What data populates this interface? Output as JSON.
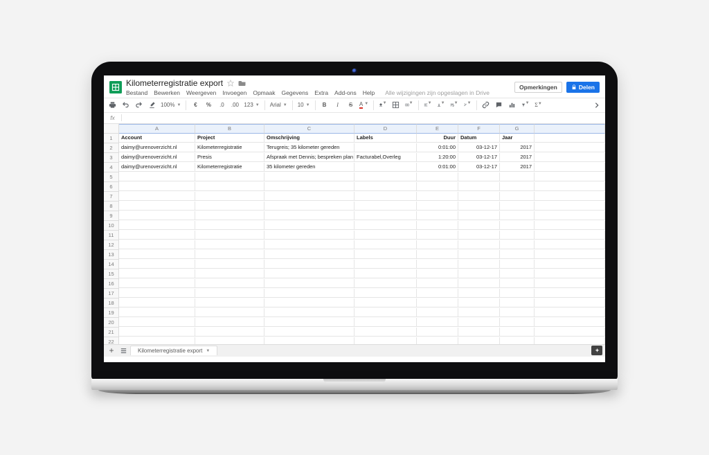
{
  "doc": {
    "title": "Kilometerregistratie export",
    "status": "Alle wijzigingen zijn opgeslagen in Drive"
  },
  "menus": [
    "Bestand",
    "Bewerken",
    "Weergeven",
    "Invoegen",
    "Opmaak",
    "Gegevens",
    "Extra",
    "Add-ons",
    "Help"
  ],
  "buttons": {
    "comments": "Opmerkingen",
    "share": "Delen"
  },
  "toolbar": {
    "zoom": "100%",
    "number_format": "123",
    "font": "Arial",
    "font_size": "10",
    "currency_icon": "€",
    "percent_icon": "%",
    "format_more": ".0",
    "format_less": ".00"
  },
  "fx_label": "fx",
  "columns": [
    "A",
    "B",
    "C",
    "D",
    "E",
    "F",
    "G"
  ],
  "headers": [
    "Account",
    "Project",
    "Omschrijving",
    "Labels",
    "Duur",
    "Datum",
    "Jaar"
  ],
  "rows": [
    {
      "account": "daimy@urenoverzicht.nl",
      "project": "Kilometerregistratie",
      "omschrijving": "Terugreis; 35 kilometer gereden",
      "labels": "",
      "duur": "0:01:00",
      "datum": "03-12-17",
      "jaar": "2017"
    },
    {
      "account": "daimy@urenoverzicht.nl",
      "project": "Presis",
      "omschrijving": "Afspraak met Dennis; bespreken plan",
      "labels": "Facturabel,Overleg",
      "duur": "1:20:00",
      "datum": "03-12-17",
      "jaar": "2017"
    },
    {
      "account": "daimy@urenoverzicht.nl",
      "project": "Kilometerregistratie",
      "omschrijving": "35 kilometer gereden",
      "labels": "",
      "duur": "0:01:00",
      "datum": "03-12-17",
      "jaar": "2017"
    }
  ],
  "sheet_tab": "Kilometerregistratie export",
  "plus": "+"
}
